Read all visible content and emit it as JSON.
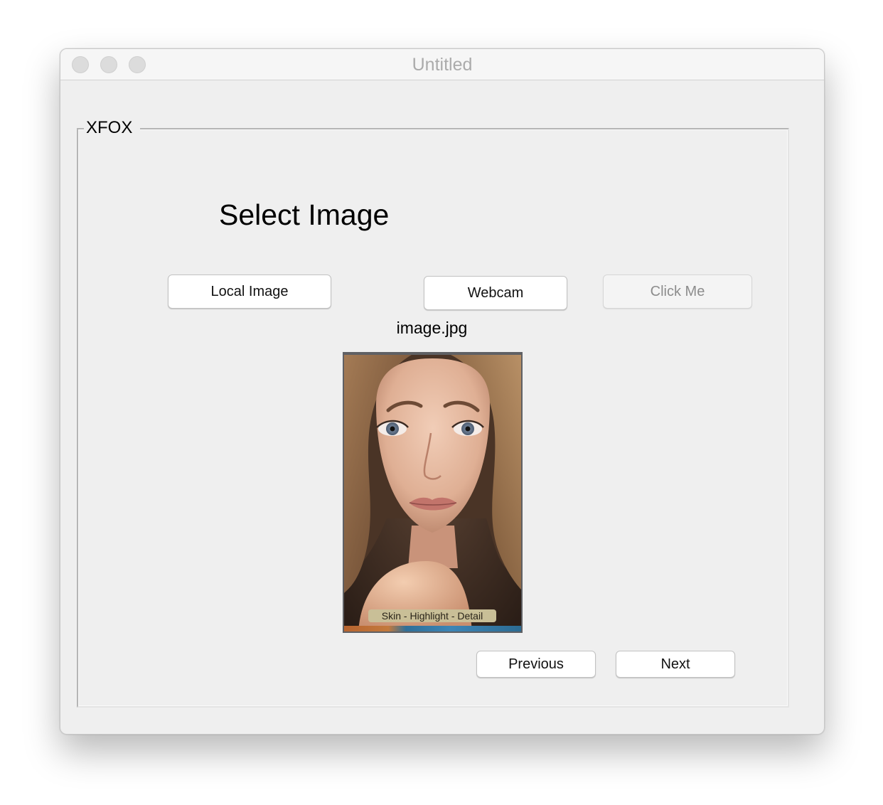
{
  "window": {
    "title": "Untitled",
    "controls": [
      "close-button",
      "minimize-button",
      "zoom-button"
    ]
  },
  "group": {
    "title": "XFOX"
  },
  "heading": "Select Image",
  "buttons": {
    "local_image": "Local Image",
    "webcam": "Webcam",
    "click_me": "Click Me",
    "previous": "Previous",
    "next": "Next"
  },
  "image": {
    "filename": "image.jpg",
    "caption": "Skin - Highlight - Detail"
  },
  "colors": {
    "window_bg": "#efefef",
    "titlebar_bg": "#f6f6f6",
    "title_text": "#ababab",
    "disabled_text": "#8c8c8c"
  }
}
